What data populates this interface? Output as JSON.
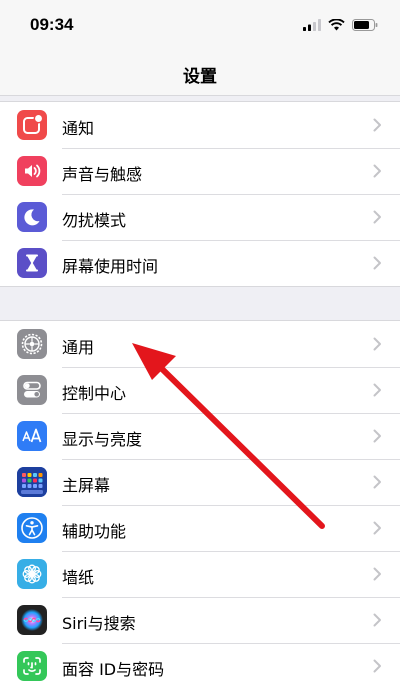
{
  "status_bar": {
    "time": "09:34",
    "icons": [
      "signal-icon",
      "wifi-icon",
      "battery-icon"
    ]
  },
  "nav": {
    "title": "设置"
  },
  "groups": [
    {
      "items": [
        {
          "label": "通知",
          "icon": "notification-icon",
          "color": "#f04a4a"
        },
        {
          "label": "声音与触感",
          "icon": "speaker-icon",
          "color": "#f0405e"
        },
        {
          "label": "勿扰模式",
          "icon": "moon-icon",
          "color": "#5b5bd6"
        },
        {
          "label": "屏幕使用时间",
          "icon": "hourglass-icon",
          "color": "#5b4fc7"
        }
      ]
    },
    {
      "items": [
        {
          "label": "通用",
          "icon": "gear-icon",
          "color": "#8e8e93"
        },
        {
          "label": "控制中心",
          "icon": "toggles-icon",
          "color": "#8e8e93"
        },
        {
          "label": "显示与亮度",
          "icon": "text-size-icon",
          "color": "#2f7cf6"
        },
        {
          "label": "主屏幕",
          "icon": "home-grid-icon",
          "color": "#2f5fd6"
        },
        {
          "label": "辅助功能",
          "icon": "accessibility-icon",
          "color": "#1f80f0"
        },
        {
          "label": "墙纸",
          "icon": "flower-icon",
          "color": "#37aee6"
        },
        {
          "label": "Siri与搜索",
          "icon": "siri-icon",
          "color": "#222222"
        },
        {
          "label": "面容 ID与密码",
          "icon": "face-id-icon",
          "color": "#34c759"
        }
      ]
    }
  ],
  "annotation": {
    "type": "red-arrow",
    "color": "#e3161c",
    "points_to": "通用"
  }
}
